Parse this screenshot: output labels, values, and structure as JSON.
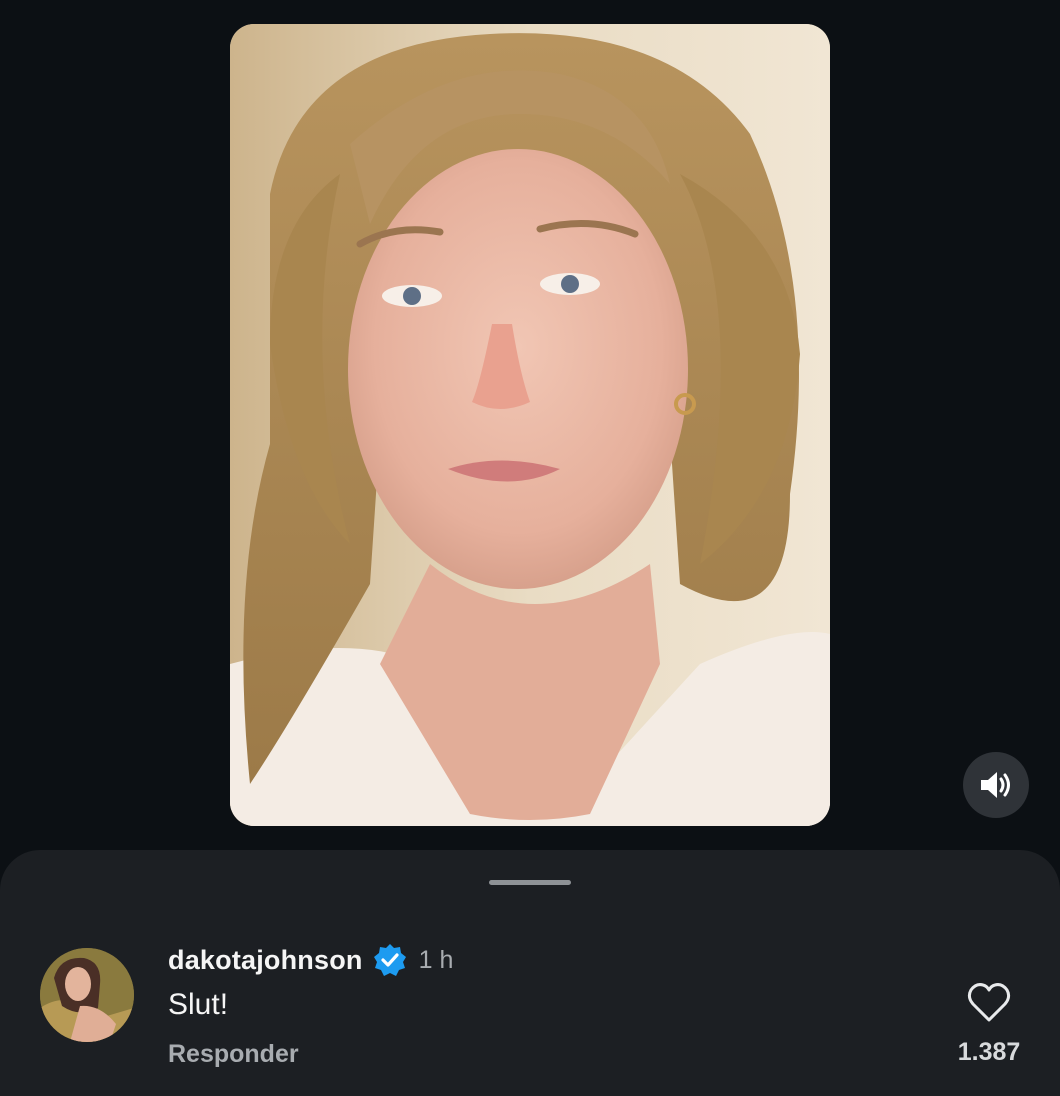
{
  "video": {
    "description_icon": "video-player",
    "sound_icon": "speaker-volume-icon"
  },
  "comments_sheet": {
    "comment": {
      "username": "dakotajohnson",
      "verified_icon": "verified-badge-icon",
      "timestamp": "1 h",
      "text": "Slut!",
      "reply_label": "Responder",
      "like_icon": "heart-outline-icon",
      "like_count": "1.387"
    }
  },
  "colors": {
    "background": "#0c1014",
    "sheet": "#1c1f23",
    "verified": "#1d9bf0",
    "muted_text": "#a8acb0"
  }
}
